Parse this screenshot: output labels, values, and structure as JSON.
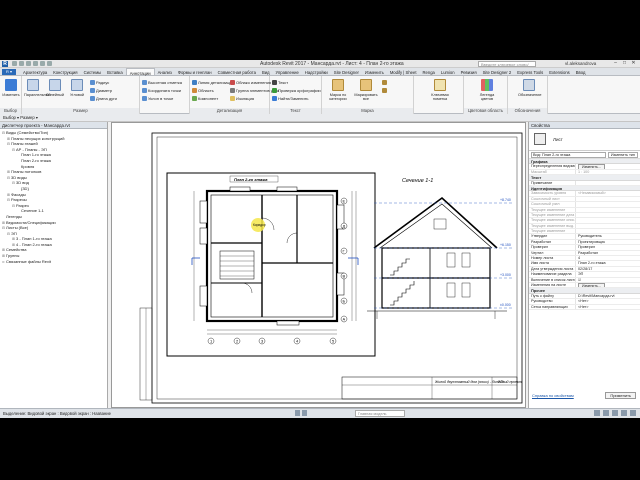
{
  "titlebar": {
    "title": "Autodesk Revit 2017 -   Мансарда.rvt - Лист: 4 - План 2-го этажа",
    "search_placeholder": "Введите ключевое слово/фразу",
    "user": "vl.aleksandrova"
  },
  "app_button": "R",
  "tabs": [
    "Архитектура",
    "Конструкция",
    "Системы",
    "Вставка",
    "Аннотации",
    "Анализ",
    "Формы и генплан",
    "Совместная работа",
    "Вид",
    "Управление",
    "Надстройки",
    "Site Designer",
    "Изменить",
    "Modify | Sheet",
    "Renga",
    "Lumion",
    "Ревизия",
    "Site Designer 2",
    "Express Tools",
    "Extensions",
    "Ввод"
  ],
  "active_tab": "Аннотации",
  "ribbon": {
    "modify_label": "Изменить",
    "groups": [
      "Выбор",
      "Размер",
      "Детализация",
      "Текст",
      "Марка",
      "Цветовая область",
      "Обозначения"
    ],
    "dimension_buttons": [
      "Параллельный",
      "Линейный",
      "Угловой"
    ],
    "dimension_small": [
      "Радиус",
      "Диаметр",
      "Длина дуги",
      "Высотная отметка",
      "Координата точки",
      "Уклон в точке"
    ],
    "detail_small": [
      "Линия детализации",
      "Область",
      "Компонент",
      "Облако изменения",
      "Группа элементов узла",
      "Изоляция"
    ],
    "text_buttons": [
      "Текст",
      "Проверка орфографии",
      "Найти/Заменить"
    ],
    "tag_buttons": [
      "Марка по категории",
      "Маркировать все",
      "Марка"
    ],
    "key_legend": "Ключевая пометка",
    "color_legend": "Легенда цветов",
    "symbol_label": "Обозначение"
  },
  "optbar": {
    "text": "Выбор ▾   Размер ▾"
  },
  "project_browser": {
    "header": "Диспетчер проекта - Мансарда.rvt",
    "nodes": [
      {
        "text": "Виды (Семейство/Тип)",
        "level": 0,
        "exp": "⊟"
      },
      {
        "text": "Планы несущих конструкций",
        "level": 1,
        "exp": "⊞"
      },
      {
        "text": "Планы этажей",
        "level": 1,
        "exp": "⊟"
      },
      {
        "text": "АР - Планы - ЭП",
        "level": 2,
        "exp": "⊟"
      },
      {
        "text": "План 1-го этажа",
        "level": 3,
        "exp": ""
      },
      {
        "text": "План 2-го этажа",
        "level": 3,
        "exp": ""
      },
      {
        "text": "Кровля",
        "level": 3,
        "exp": ""
      },
      {
        "text": "Планы потолков",
        "level": 1,
        "exp": "⊞"
      },
      {
        "text": "3D виды",
        "level": 1,
        "exp": "⊟"
      },
      {
        "text": "3D вид",
        "level": 2,
        "exp": "⊟"
      },
      {
        "text": "{3D}",
        "level": 3,
        "exp": ""
      },
      {
        "text": "Фасады",
        "level": 1,
        "exp": "⊞"
      },
      {
        "text": "Разрезы",
        "level": 1,
        "exp": "⊟"
      },
      {
        "text": "Разрез",
        "level": 2,
        "exp": "⊟"
      },
      {
        "text": "Сечение 1-1",
        "level": 3,
        "exp": ""
      },
      {
        "text": "Легенды",
        "level": 0,
        "exp": ""
      },
      {
        "text": "Ведомости/Спецификации",
        "level": 0,
        "exp": "⊞"
      },
      {
        "text": "Листы (Все)",
        "level": 0,
        "exp": "⊟"
      },
      {
        "text": "ЭП",
        "level": 1,
        "exp": "⊟"
      },
      {
        "text": "3 - План 1-го этажа",
        "level": 2,
        "exp": "⊞"
      },
      {
        "text": "4 - План 2-го этажа",
        "level": 2,
        "exp": "⊞"
      },
      {
        "text": "Семейства",
        "level": 0,
        "exp": "⊞"
      },
      {
        "text": "Группы",
        "level": 0,
        "exp": "⊞"
      },
      {
        "text": "Связанные файлы Revit",
        "level": 0,
        "exp": "∞"
      }
    ]
  },
  "canvas": {
    "plan_title": "План 2-го этажа",
    "section_title": "Сечение 1-1",
    "grid_letters": [
      "Е",
      "Д",
      "Г",
      "В",
      "Б",
      "А"
    ],
    "grid_numbers": [
      "1",
      "2",
      "3",
      "4",
      "5"
    ],
    "sheet_caption": "Жилой двухэтажный дом (эскиз) - Линейный проект",
    "sheet_number": "2/3",
    "level_marks": [
      "+6.150",
      "+3.000",
      "±0.000",
      "+8.740"
    ],
    "room_label": "Коридор"
  },
  "properties": {
    "header": "Свойства",
    "type_name": "Лист",
    "selector": "Вид: План 2-го этажа",
    "edit_type": "Изменить тип",
    "rows": [
      {
        "cat": "Графика"
      },
      {
        "n": "Переопределения видимости",
        "v": "Изменить...",
        "btn": true
      },
      {
        "n": "Масштаб",
        "v": "1 : 100",
        "dim": true
      },
      {
        "cat": "Текст"
      },
      {
        "n": "Примечание",
        "v": ""
      },
      {
        "cat": "Идентификация"
      },
      {
        "n": "Зависимость уровня",
        "v": "<Независимый>",
        "dim": true
      },
      {
        "n": "Ссылочный лист",
        "v": "",
        "dim": true
      },
      {
        "n": "Ссылочный узел",
        "v": "",
        "dim": true
      },
      {
        "n": "Текущее изменение",
        "v": "",
        "dim": true
      },
      {
        "n": "Текущее изменение дата",
        "v": "",
        "dim": true
      },
      {
        "n": "Текущее изменение опис.",
        "v": "",
        "dim": true
      },
      {
        "n": "Текущее изменение выд.",
        "v": "",
        "dim": true
      },
      {
        "n": "Текущее изменение",
        "v": "",
        "dim": true
      },
      {
        "n": "Утвердил",
        "v": "Руководитель"
      },
      {
        "n": "Разработал",
        "v": "Проектировщик"
      },
      {
        "n": "Проверил",
        "v": "Проверил"
      },
      {
        "n": "Чертил",
        "v": "Разработал"
      },
      {
        "n": "Номер листа",
        "v": "4"
      },
      {
        "n": "Имя листа",
        "v": "План 2-го этажа"
      },
      {
        "n": "Дата утверждения листа",
        "v": "02/28/17"
      },
      {
        "n": "Наименование раздела",
        "v": "ЭП"
      },
      {
        "n": "Включение в список листов",
        "v": "☑"
      },
      {
        "n": "Изменения на листе",
        "v": "Изменить...",
        "btn": true
      },
      {
        "cat": "Прочее"
      },
      {
        "n": "Путь к файлу",
        "v": "D:\\Revit\\Мансарда.rvt"
      },
      {
        "n": "Руководство",
        "v": "<Нет>"
      },
      {
        "n": "Сетка направляющих",
        "v": "<Нет>"
      }
    ],
    "help_link": "Справка по свойствам",
    "apply": "Применить"
  },
  "status": {
    "text": "Выделение: Видовой экран : Видовой экран : Название",
    "model_placeholder": "Главная модель"
  }
}
